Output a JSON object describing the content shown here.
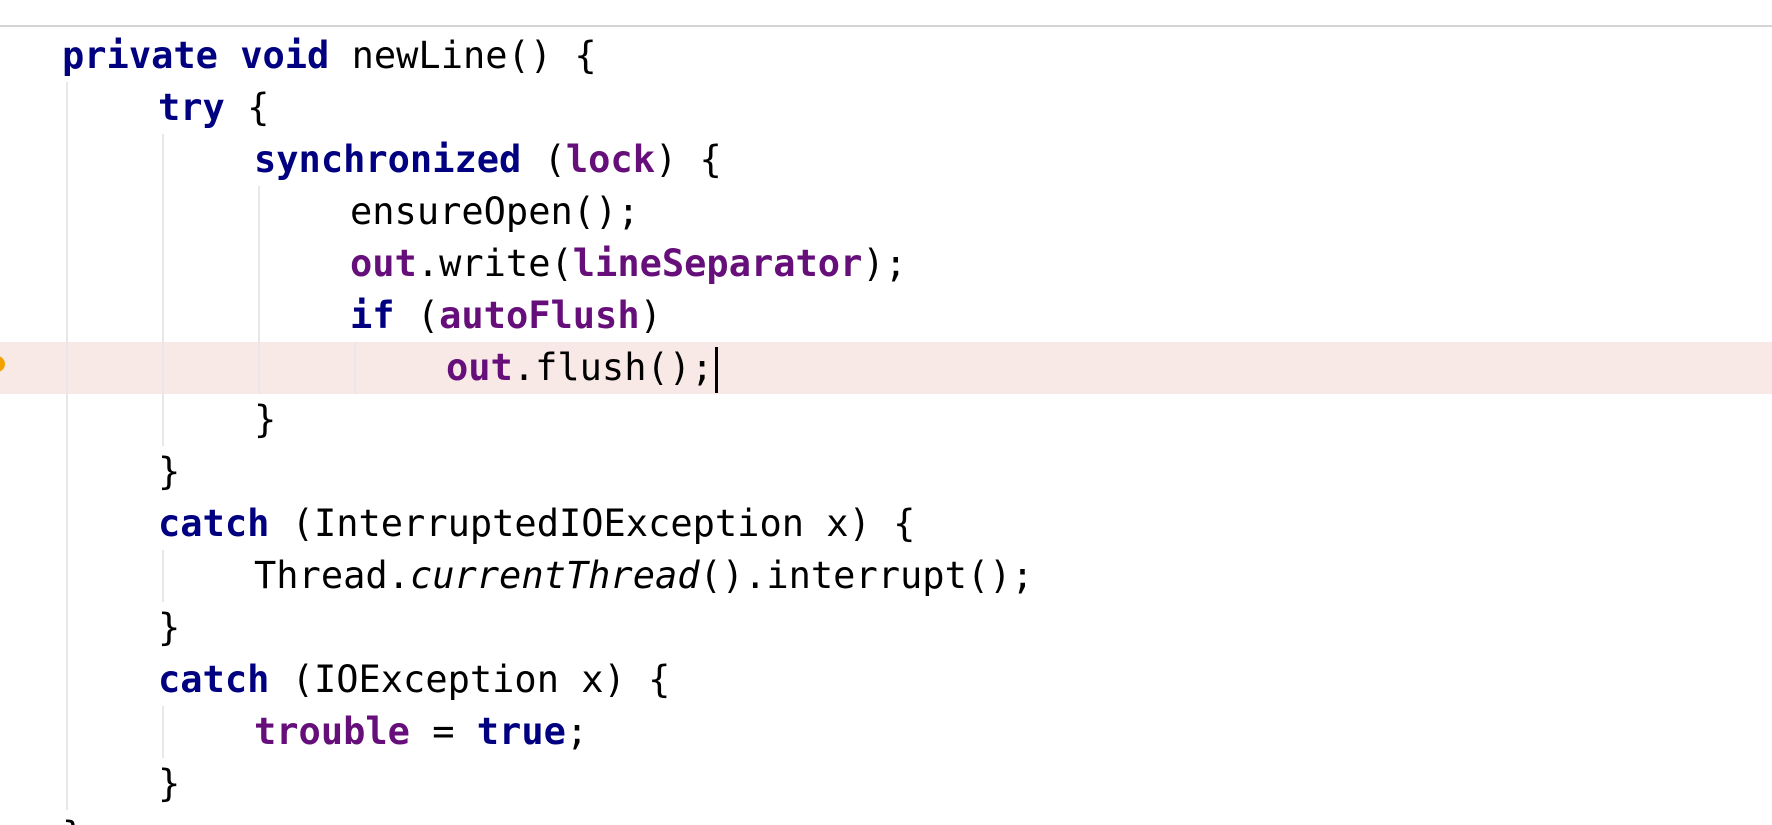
{
  "editor": {
    "language": "Java",
    "lines": [
      {
        "indent": 0,
        "tokens": [
          {
            "t": "private",
            "c": "kw"
          },
          {
            "t": " "
          },
          {
            "t": "void",
            "c": "kw"
          },
          {
            "t": " newLine() {"
          }
        ]
      },
      {
        "indent": 1,
        "tokens": [
          {
            "t": "try",
            "c": "kw"
          },
          {
            "t": " {"
          }
        ]
      },
      {
        "indent": 2,
        "tokens": [
          {
            "t": "synchronized",
            "c": "kw"
          },
          {
            "t": " ("
          },
          {
            "t": "lock",
            "c": "fld"
          },
          {
            "t": ") {"
          }
        ]
      },
      {
        "indent": 3,
        "tokens": [
          {
            "t": "ensureOpen();"
          }
        ]
      },
      {
        "indent": 3,
        "tokens": [
          {
            "t": "out",
            "c": "fld"
          },
          {
            "t": ".write("
          },
          {
            "t": "lineSeparator",
            "c": "fld"
          },
          {
            "t": ");"
          }
        ]
      },
      {
        "indent": 3,
        "tokens": [
          {
            "t": "if",
            "c": "kw"
          },
          {
            "t": " ("
          },
          {
            "t": "autoFlush",
            "c": "fld"
          },
          {
            "t": ")"
          }
        ]
      },
      {
        "indent": 4,
        "current": true,
        "gutter_icon": "intention-bulb-icon",
        "tokens": [
          {
            "t": "out",
            "c": "fld"
          },
          {
            "t": ".flush();"
          }
        ]
      },
      {
        "indent": 2,
        "tokens": [
          {
            "t": "}"
          }
        ]
      },
      {
        "indent": 1,
        "tokens": [
          {
            "t": "}"
          }
        ]
      },
      {
        "indent": 1,
        "tokens": [
          {
            "t": "catch",
            "c": "kw"
          },
          {
            "t": " (InterruptedIOException x) {"
          }
        ]
      },
      {
        "indent": 2,
        "tokens": [
          {
            "t": "Thread."
          },
          {
            "t": "currentThread",
            "c": "static-call"
          },
          {
            "t": "().interrupt();"
          }
        ]
      },
      {
        "indent": 1,
        "tokens": [
          {
            "t": "}"
          }
        ]
      },
      {
        "indent": 1,
        "tokens": [
          {
            "t": "catch",
            "c": "kw"
          },
          {
            "t": " (IOException x) {"
          }
        ]
      },
      {
        "indent": 2,
        "tokens": [
          {
            "t": "trouble",
            "c": "fld"
          },
          {
            "t": " = "
          },
          {
            "t": "true",
            "c": "kw"
          },
          {
            "t": ";"
          }
        ]
      },
      {
        "indent": 1,
        "tokens": [
          {
            "t": "}"
          }
        ]
      },
      {
        "indent": 0,
        "tokens": [
          {
            "t": "}"
          }
        ]
      }
    ]
  },
  "colors": {
    "keyword": "#000080",
    "field": "#660e7a",
    "current_line_bg": "#f9e9e6",
    "indent_guide": "#e8e8e8",
    "bulb": "#f2a100"
  }
}
